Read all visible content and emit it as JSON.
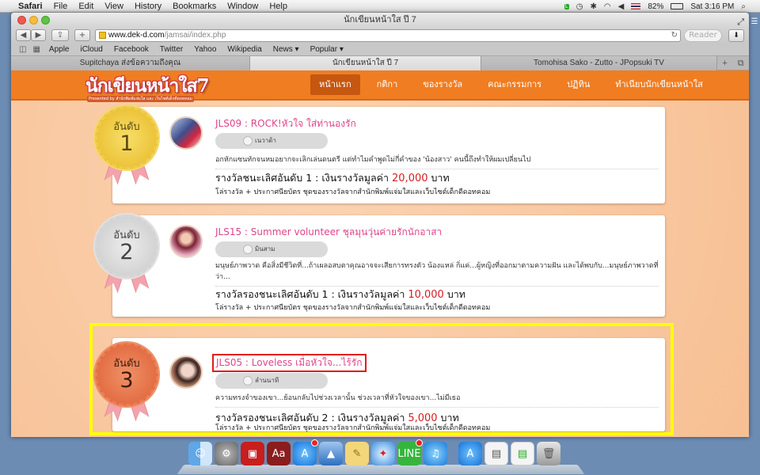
{
  "menubar": {
    "app": "Safari",
    "items": [
      "File",
      "Edit",
      "View",
      "History",
      "Bookmarks",
      "Window",
      "Help"
    ],
    "battery": "82%",
    "clock": "Sat 3:16 PM"
  },
  "window": {
    "title": "นักเขียนหน้าใส ปี 7",
    "url_host": "www.dek-d.com",
    "url_path": "/jamsai/index.php",
    "reader_label": "Reader",
    "bookmarks": [
      "Apple",
      "iCloud",
      "Facebook",
      "Twitter",
      "Yahoo",
      "Wikipedia",
      "News ▾",
      "Popular ▾"
    ],
    "tabs": [
      {
        "label": "Supitchaya ส่งข้อความถึงคุณ",
        "active": false
      },
      {
        "label": "นักเขียนหน้าใส ปี 7",
        "active": true
      },
      {
        "label": "Tomohisa Sako - Zutto - JPopsuki TV",
        "active": false
      }
    ]
  },
  "site": {
    "logo_text": "นักเขียนหน้าใส7",
    "logo_sub": "Presented by สำนักพิมพ์แจ่มใส และ เว็บไซต์เด็กดีดอทคอม",
    "nav": [
      {
        "label": "หน้าแรก",
        "active": true
      },
      {
        "label": "กติกา",
        "active": false
      },
      {
        "label": "ของรางวัล",
        "active": false
      },
      {
        "label": "คณะกรรมการ",
        "active": false
      },
      {
        "label": "ปฏิทิน",
        "active": false
      },
      {
        "label": "ทำเนียบนักเขียนหน้าใส",
        "active": false
      }
    ]
  },
  "winners": [
    {
      "rank_label": "อันดับ",
      "rank": "1",
      "title": "JLS09 : ROCK!หัวใจ ใส่ท่านองรัก",
      "author": "เนวาด้า",
      "excerpt": "อกหักแซนทักจนหมอยากจะเลิกเล่นดนตรี แต่ทำไมคำพูดไม่กี่คำของ 'น้องสาว' คนนี้ถึงทำให้ผมเปลี่ยนไป",
      "award_prefix": "รางวัลชนะเลิศอันดับ 1 : เงินรางวัลมูลค่า",
      "amount": "20,000",
      "unit": "บาท",
      "prize": "โล่รางวัล + ประกาศนียบัตร ชุดของรางวัลจากสำนักพิมพ์แจ่มใสและเว็บไซต์เด็กดีดอทคอม"
    },
    {
      "rank_label": "อันดับ",
      "rank": "2",
      "title": "JLS15 : Summer volunteer ชุลมุนวุ่นค่ายรักนักอาสา",
      "author": "มินสาม",
      "excerpt": "มนุษย์ภาพวาด คือสิ่งมีชีวิตที่...ถ้าเผลอสบตาคุณอาจจะเสียการทรงตัว น้องแหล่ กิ่แค่...ผู้หญิงที่ออกมาตามความฝัน และได้พบกับ...มนุษย์ภาพวาดที่ว่า...",
      "award_prefix": "รางวัลรองชนะเลิศอันดับ 1 : เงินรางวัลมูลค่า",
      "amount": "10,000",
      "unit": "บาท",
      "prize": "โล่รางวัล + ประกาศนียบัตร ชุดของรางวัลจากสำนักพิมพ์แจ่มใสและเว็บไซต์เด็กดีดอทคอม"
    },
    {
      "rank_label": "อันดับ",
      "rank": "3",
      "title": "JLS05 : Loveless เมื่อหัวใจ...ไร้รัก",
      "author": "ลำนนาที",
      "excerpt": "ความทรงจำของเขา...ย้อนกลับไปช่วงเวลานั้น ช่วงเวลาที่หัวใจของเขา...ไม่มีเธอ",
      "award_prefix": "รางวัลรองชนะเลิศอันดับ 2 : เงินรางวัลมูลค่า",
      "amount": "5,000",
      "unit": "บาท",
      "prize": "โล่รางวัล + ประกาศนียบัตร ชุดของรางวัลจากสำนักพิมพ์แจ่มใสและเว็บไซต์เด็กดีดอทคอม"
    }
  ],
  "dock": [
    "finder-icon",
    "system-preferences-icon",
    "photo-booth-icon",
    "dictionary-icon",
    "app-store-icon",
    "keynote-icon",
    "notes-icon",
    "safari-icon",
    "line-icon",
    "itunes-icon",
    "app-store-2-icon",
    "documents-icon",
    "line-2-icon",
    "trash-icon"
  ]
}
